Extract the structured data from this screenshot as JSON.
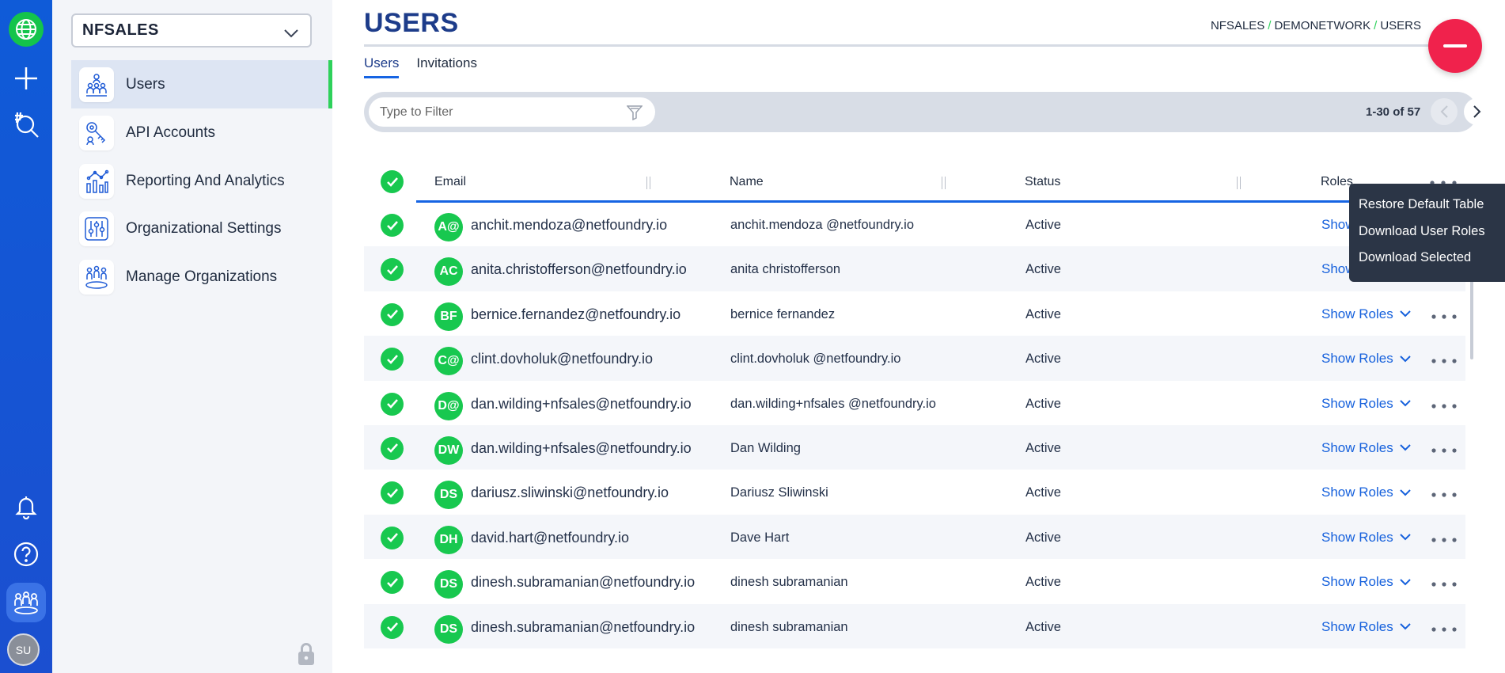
{
  "rail": {
    "icons": [
      "globe-icon",
      "plus-icon",
      "hashtag-search-icon",
      "bell-icon",
      "help-icon",
      "team-icon"
    ],
    "user_initials": "SU"
  },
  "sidenav": {
    "org": "NFSALES",
    "items": [
      {
        "label": "Users",
        "icon": "users-icon",
        "active": true
      },
      {
        "label": "API Accounts",
        "icon": "api-key-icon",
        "active": false
      },
      {
        "label": "Reporting And Analytics",
        "icon": "chart-icon",
        "active": false
      },
      {
        "label": "Organizational Settings",
        "icon": "sliders-icon",
        "active": false
      },
      {
        "label": "Manage Organizations",
        "icon": "organizations-icon",
        "active": false
      }
    ]
  },
  "header": {
    "title": "USERS",
    "breadcrumb": [
      "NFSALES",
      "DEMONETWORK",
      "USERS"
    ]
  },
  "tabs": [
    {
      "label": "Users",
      "active": true
    },
    {
      "label": "Invitations",
      "active": false
    }
  ],
  "filter": {
    "placeholder": "Type to Filter",
    "value": ""
  },
  "pager": {
    "range": "1-30 of 57"
  },
  "table": {
    "columns": {
      "email": "Email",
      "name": "Name",
      "status": "Status",
      "roles": "Roles"
    },
    "roles_link": "Show Roles",
    "rows": [
      {
        "initials": "A@",
        "email": "anchit.mendoza@netfoundry.io",
        "name": "anchit.mendoza @netfoundry.io",
        "status": "Active",
        "roles": "Show",
        "alt": false
      },
      {
        "initials": "AC",
        "email": "anita.christofferson@netfoundry.io",
        "name": "anita christofferson",
        "status": "Active",
        "roles": "Show",
        "alt": true
      },
      {
        "initials": "BF",
        "email": "bernice.fernandez@netfoundry.io",
        "name": "bernice fernandez",
        "status": "Active",
        "roles": "Show Roles",
        "alt": false
      },
      {
        "initials": "C@",
        "email": "clint.dovholuk@netfoundry.io",
        "name": "clint.dovholuk @netfoundry.io",
        "status": "Active",
        "roles": "Show Roles",
        "alt": true
      },
      {
        "initials": "D@",
        "email": "dan.wilding+nfsales@netfoundry.io",
        "name": "dan.wilding+nfsales @netfoundry.io",
        "status": "Active",
        "roles": "Show Roles",
        "alt": false
      },
      {
        "initials": "DW",
        "email": "dan.wilding+nfsales@netfoundry.io",
        "name": "Dan Wilding",
        "status": "Active",
        "roles": "Show Roles",
        "alt": true
      },
      {
        "initials": "DS",
        "email": "dariusz.sliwinski@netfoundry.io",
        "name": "Dariusz Sliwinski",
        "status": "Active",
        "roles": "Show Roles",
        "alt": false
      },
      {
        "initials": "DH",
        "email": "david.hart@netfoundry.io",
        "name": "Dave Hart",
        "status": "Active",
        "roles": "Show Roles",
        "alt": true
      },
      {
        "initials": "DS",
        "email": "dinesh.subramanian@netfoundry.io",
        "name": "dinesh subramanian",
        "status": "Active",
        "roles": "Show Roles",
        "alt": false
      },
      {
        "initials": "DS",
        "email": "dinesh.subramanian@netfoundry.io",
        "name": "dinesh subramanian",
        "status": "Active",
        "roles": "Show Roles",
        "alt": true
      }
    ]
  },
  "context_menu": {
    "items": [
      "Restore Default Table",
      "Download User Roles",
      "Download Selected"
    ]
  },
  "colors": {
    "rail": "#0f5bd8",
    "accent_green": "#18c84f",
    "accent_blue": "#1664e3",
    "fab_red": "#f0224c",
    "menu_bg": "#2b3546"
  }
}
